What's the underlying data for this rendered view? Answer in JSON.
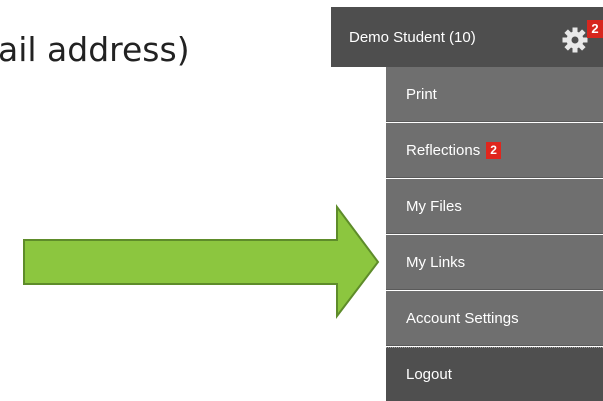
{
  "background_text": "ail address)",
  "header": {
    "user_label": "Demo Student (10)",
    "gear_icon": "gear-icon",
    "notification_count": "2"
  },
  "menu": {
    "items": [
      {
        "label": "Print"
      },
      {
        "label": "Reflections",
        "badge": "2"
      },
      {
        "label": "My Files"
      },
      {
        "label": "My Links"
      },
      {
        "label": "Account Settings"
      },
      {
        "label": "Logout"
      }
    ]
  },
  "colors": {
    "header_bg": "#4e4e4e",
    "item_bg": "#6f6f6f",
    "logout_bg": "#4f4f4f",
    "badge": "#d7261e",
    "arrow_fill": "#8cc63f",
    "arrow_stroke": "#5e8c2a"
  }
}
